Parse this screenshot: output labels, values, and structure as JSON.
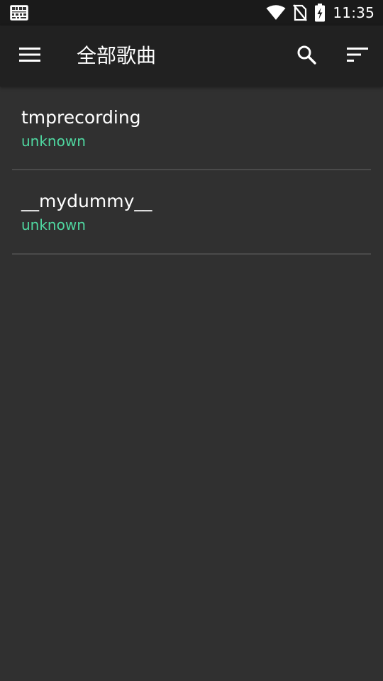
{
  "status_bar": {
    "time": "11:35",
    "icons": [
      "app-notification-icon",
      "wifi-icon",
      "no-sim-icon",
      "battery-charging-icon"
    ]
  },
  "toolbar": {
    "title": "全部歌曲",
    "menu_icon": "menu-icon",
    "search_icon": "search-icon",
    "sort_icon": "sort-icon"
  },
  "songs": [
    {
      "title": "tmprecording",
      "artist": "unknown"
    },
    {
      "title": "__mydummy__",
      "artist": "unknown"
    }
  ],
  "colors": {
    "background": "#303030",
    "toolbar": "#212121",
    "status_bar": "#1a1a1a",
    "accent": "#4fd7a0",
    "divider": "#4a4a4a",
    "text_primary": "#ffffff"
  }
}
